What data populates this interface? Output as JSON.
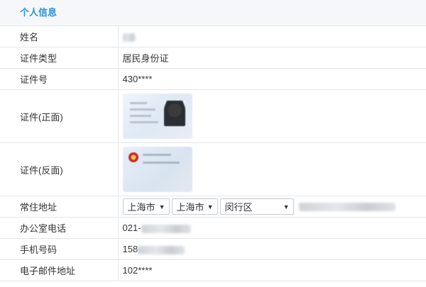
{
  "section": {
    "title": "个人信息"
  },
  "rows": {
    "name": {
      "label": "姓名"
    },
    "id_type": {
      "label": "证件类型",
      "value": "居民身份证"
    },
    "id_number": {
      "label": "证件号",
      "value": "430****"
    },
    "id_front": {
      "label": "证件(正面)"
    },
    "id_back": {
      "label": "证件(反面)"
    },
    "address": {
      "label": "常住地址",
      "province": "上海市",
      "city": "上海市",
      "district": "闵行区"
    },
    "office_phone": {
      "label": "办公室电话",
      "prefix": "021-"
    },
    "mobile": {
      "label": "手机号码",
      "prefix": "158"
    },
    "email": {
      "label": "电子邮件地址",
      "value": "102****"
    }
  },
  "icons": {
    "dropdown": "triangle-down-icon"
  },
  "colors": {
    "section_title": "#2a8fd6",
    "border": "#e3e6ea",
    "header_bg": "#f5f7fb"
  }
}
